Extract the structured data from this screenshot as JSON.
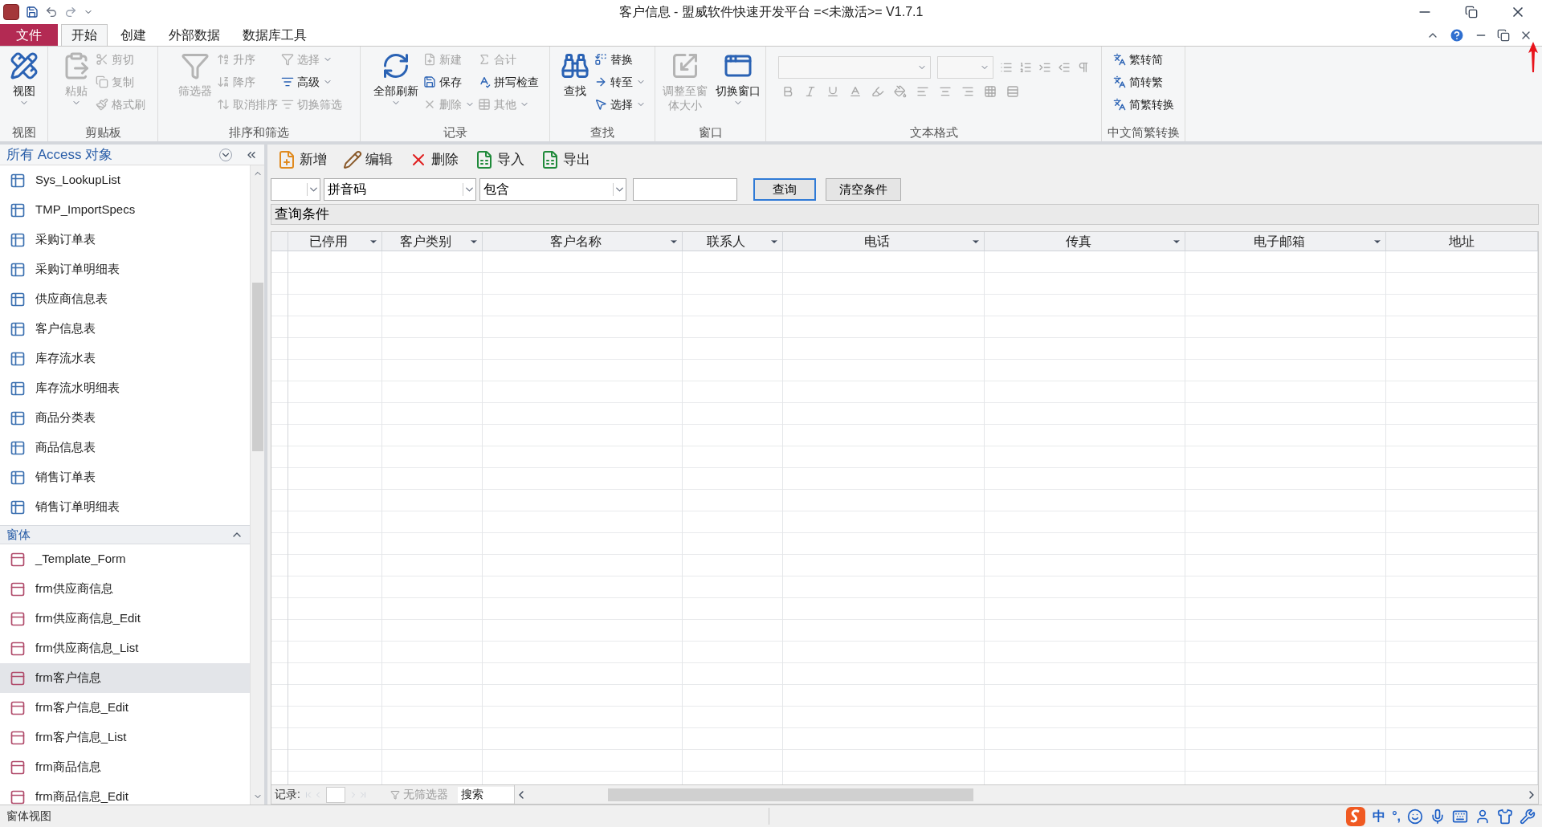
{
  "window": {
    "title": "客户信息 - 盟威软件快速开发平台 =<未激活>= V1.7.1"
  },
  "menu_tabs": [
    {
      "label": "文件",
      "kind": "file",
      "selected": false
    },
    {
      "label": "开始",
      "kind": "tab",
      "selected": true
    },
    {
      "label": "创建",
      "kind": "tab",
      "selected": false
    },
    {
      "label": "外部数据",
      "kind": "tab",
      "selected": false
    },
    {
      "label": "数据库工具",
      "kind": "tab",
      "selected": false
    }
  ],
  "ribbon_groups": [
    {
      "title": "视图",
      "kind": "buttons",
      "columns": [
        [
          {
            "label": "视图",
            "kind": "large",
            "disabled": false,
            "has_menu": true
          }
        ]
      ]
    },
    {
      "title": "剪贴板",
      "kind": "buttons",
      "columns": [
        [
          {
            "label": "粘贴",
            "kind": "large",
            "disabled": true,
            "has_menu": true
          }
        ],
        [
          {
            "label": "剪切",
            "kind": "small",
            "disabled": true,
            "has_menu": false
          },
          {
            "label": "复制",
            "kind": "small",
            "disabled": true,
            "has_menu": false
          },
          {
            "label": "格式刷",
            "kind": "small",
            "disabled": true,
            "has_menu": false
          }
        ]
      ]
    },
    {
      "title": "排序和筛选",
      "kind": "buttons",
      "columns": [
        [
          {
            "label": "筛选器",
            "kind": "large",
            "disabled": true,
            "has_menu": false
          }
        ],
        [
          {
            "label": "升序",
            "kind": "small",
            "disabled": true,
            "has_menu": false
          },
          {
            "label": "降序",
            "kind": "small",
            "disabled": true,
            "has_menu": false
          },
          {
            "label": "取消排序",
            "kind": "small",
            "disabled": true,
            "has_menu": false
          }
        ],
        [
          {
            "label": "选择",
            "kind": "small",
            "disabled": true,
            "has_menu": true
          },
          {
            "label": "高级",
            "kind": "small",
            "disabled": false,
            "has_menu": true
          },
          {
            "label": "切换筛选",
            "kind": "small",
            "disabled": true,
            "has_menu": false
          }
        ]
      ]
    },
    {
      "title": "记录",
      "kind": "buttons",
      "columns": [
        [
          {
            "label": "全部刷新",
            "kind": "large",
            "disabled": false,
            "has_menu": true
          }
        ],
        [
          {
            "label": "新建",
            "kind": "small",
            "disabled": true,
            "has_menu": false
          },
          {
            "label": "保存",
            "kind": "small",
            "disabled": false,
            "has_menu": false
          },
          {
            "label": "删除",
            "kind": "small",
            "disabled": true,
            "has_menu": true
          }
        ],
        [
          {
            "label": "合计",
            "kind": "small",
            "disabled": true,
            "has_menu": false
          },
          {
            "label": "拼写检查",
            "kind": "small",
            "disabled": false,
            "has_menu": false
          },
          {
            "label": "其他",
            "kind": "small",
            "disabled": true,
            "has_menu": true
          }
        ]
      ]
    },
    {
      "title": "查找",
      "kind": "buttons",
      "columns": [
        [
          {
            "label": "查找",
            "kind": "large",
            "disabled": false,
            "has_menu": false
          }
        ],
        [
          {
            "label": "替换",
            "kind": "small",
            "disabled": false,
            "has_menu": false
          },
          {
            "label": "转至",
            "kind": "small",
            "disabled": false,
            "has_menu": true
          },
          {
            "label": "选择",
            "kind": "small",
            "disabled": false,
            "has_menu": true
          }
        ]
      ]
    },
    {
      "title": "窗口",
      "kind": "buttons",
      "columns": [
        [
          {
            "label": "调整至窗体大小",
            "kind": "large",
            "disabled": true,
            "has_menu": false
          }
        ],
        [
          {
            "label": "切换窗口",
            "kind": "large",
            "disabled": false,
            "has_menu": true
          }
        ]
      ]
    },
    {
      "title": "文本格式",
      "kind": "text_format",
      "disabled": true
    },
    {
      "title": "中文简繁转换",
      "kind": "buttons",
      "columns": [
        [
          {
            "label": "繁转简",
            "kind": "small",
            "disabled": false,
            "has_menu": false
          },
          {
            "label": "简转繁",
            "kind": "small",
            "disabled": false,
            "has_menu": false
          },
          {
            "label": "简繁转换",
            "kind": "small",
            "disabled": false,
            "has_menu": false
          }
        ]
      ]
    }
  ],
  "nav_pane": {
    "title": "所有 Access 对象",
    "table_items": [
      {
        "label": "Sys_LookupList",
        "selected": false
      },
      {
        "label": "TMP_ImportSpecs",
        "selected": false
      },
      {
        "label": "采购订单表",
        "selected": false
      },
      {
        "label": "采购订单明细表",
        "selected": false
      },
      {
        "label": "供应商信息表",
        "selected": false
      },
      {
        "label": "客户信息表",
        "selected": false
      },
      {
        "label": "库存流水表",
        "selected": false
      },
      {
        "label": "库存流水明细表",
        "selected": false
      },
      {
        "label": "商品分类表",
        "selected": false
      },
      {
        "label": "商品信息表",
        "selected": false
      },
      {
        "label": "销售订单表",
        "selected": false
      },
      {
        "label": "销售订单明细表",
        "selected": false
      }
    ],
    "form_section": {
      "title": "窗体",
      "expanded": true,
      "items": [
        {
          "label": "_Template_Form",
          "selected": false
        },
        {
          "label": "frm供应商信息",
          "selected": false
        },
        {
          "label": "frm供应商信息_Edit",
          "selected": false
        },
        {
          "label": "frm供应商信息_List",
          "selected": false
        },
        {
          "label": "frm客户信息",
          "selected": true
        },
        {
          "label": "frm客户信息_Edit",
          "selected": false
        },
        {
          "label": "frm客户信息_List",
          "selected": false
        },
        {
          "label": "frm商品信息",
          "selected": false
        },
        {
          "label": "frm商品信息_Edit",
          "selected": false
        }
      ]
    }
  },
  "form_toolbar": [
    {
      "label": "新增"
    },
    {
      "label": "编辑"
    },
    {
      "label": "删除"
    },
    {
      "label": "导入"
    },
    {
      "label": "导出"
    }
  ],
  "filter": {
    "field": "拼音码",
    "operator": "包含",
    "buttons": [
      {
        "label": "查询",
        "focused": true
      },
      {
        "label": "清空条件",
        "focused": false
      }
    ]
  },
  "query_label": "查询条件",
  "columns": [
    {
      "label": "已停用",
      "has_menu": true
    },
    {
      "label": "客户类别",
      "has_menu": true
    },
    {
      "label": "客户名称",
      "has_menu": true
    },
    {
      "label": "联系人",
      "has_menu": true
    },
    {
      "label": "电话",
      "has_menu": true
    },
    {
      "label": "传真",
      "has_menu": true
    },
    {
      "label": "电子邮箱",
      "has_menu": true
    },
    {
      "label": "地址",
      "has_menu": false
    }
  ],
  "record_nav": {
    "label": "记录:",
    "filter_status": "无筛选器",
    "search_placeholder": "搜索"
  },
  "status_bar": {
    "text": "窗体视图",
    "ime_labels": [
      "中",
      "°,"
    ]
  }
}
